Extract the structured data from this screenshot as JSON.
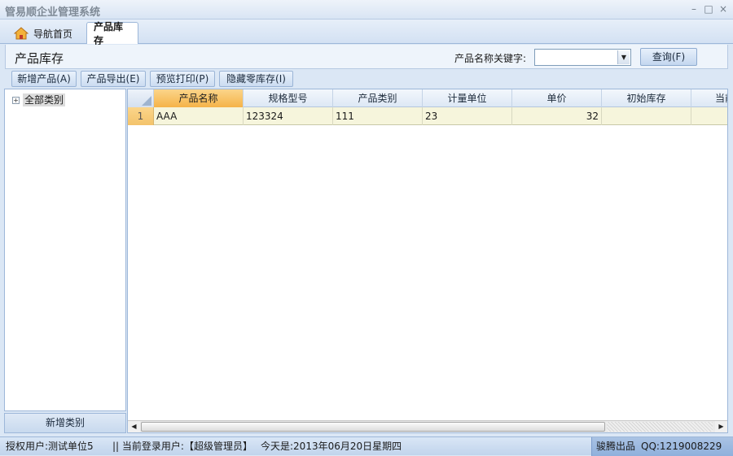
{
  "window": {
    "title": "管易顺企业管理系统",
    "controls": [
      "–",
      "□",
      "×"
    ]
  },
  "tabs": [
    {
      "label": "导航首页",
      "icon": "home-icon"
    },
    {
      "label": "产品库存",
      "active": true
    }
  ],
  "header": {
    "page_title": "产品库存",
    "search_label": "产品名称关键字:",
    "search_value": "",
    "query_button": "查询(F)"
  },
  "toolbar": {
    "add_product": "新增产品(A)",
    "export": "产品导出(E)",
    "print_preview": "预览打印(P)",
    "hide_zero": "隐藏零库存(I)"
  },
  "tree": {
    "root_label": "全部类别",
    "expander": "+"
  },
  "add_category_button": "新增类别",
  "grid": {
    "columns": [
      "产品名称",
      "规格型号",
      "产品类别",
      "计量单位",
      "单价",
      "初始库存",
      "当前"
    ],
    "rows": [
      {
        "index": "1",
        "cells": [
          "AAA",
          "123324",
          "111",
          "23",
          "32",
          "",
          ""
        ]
      }
    ]
  },
  "statusbar": {
    "authorized_user": "授权用户:测试单位5",
    "current_user": "|| 当前登录用户:【超级管理员】",
    "today": "今天是:2013年06月20日星期四",
    "vendor": "骏腾出品",
    "qq": "QQ:1219008229"
  },
  "colors": {
    "accent": "#f5b348",
    "frame": "#9db7d9",
    "row_bg": "#f6f5dc"
  }
}
